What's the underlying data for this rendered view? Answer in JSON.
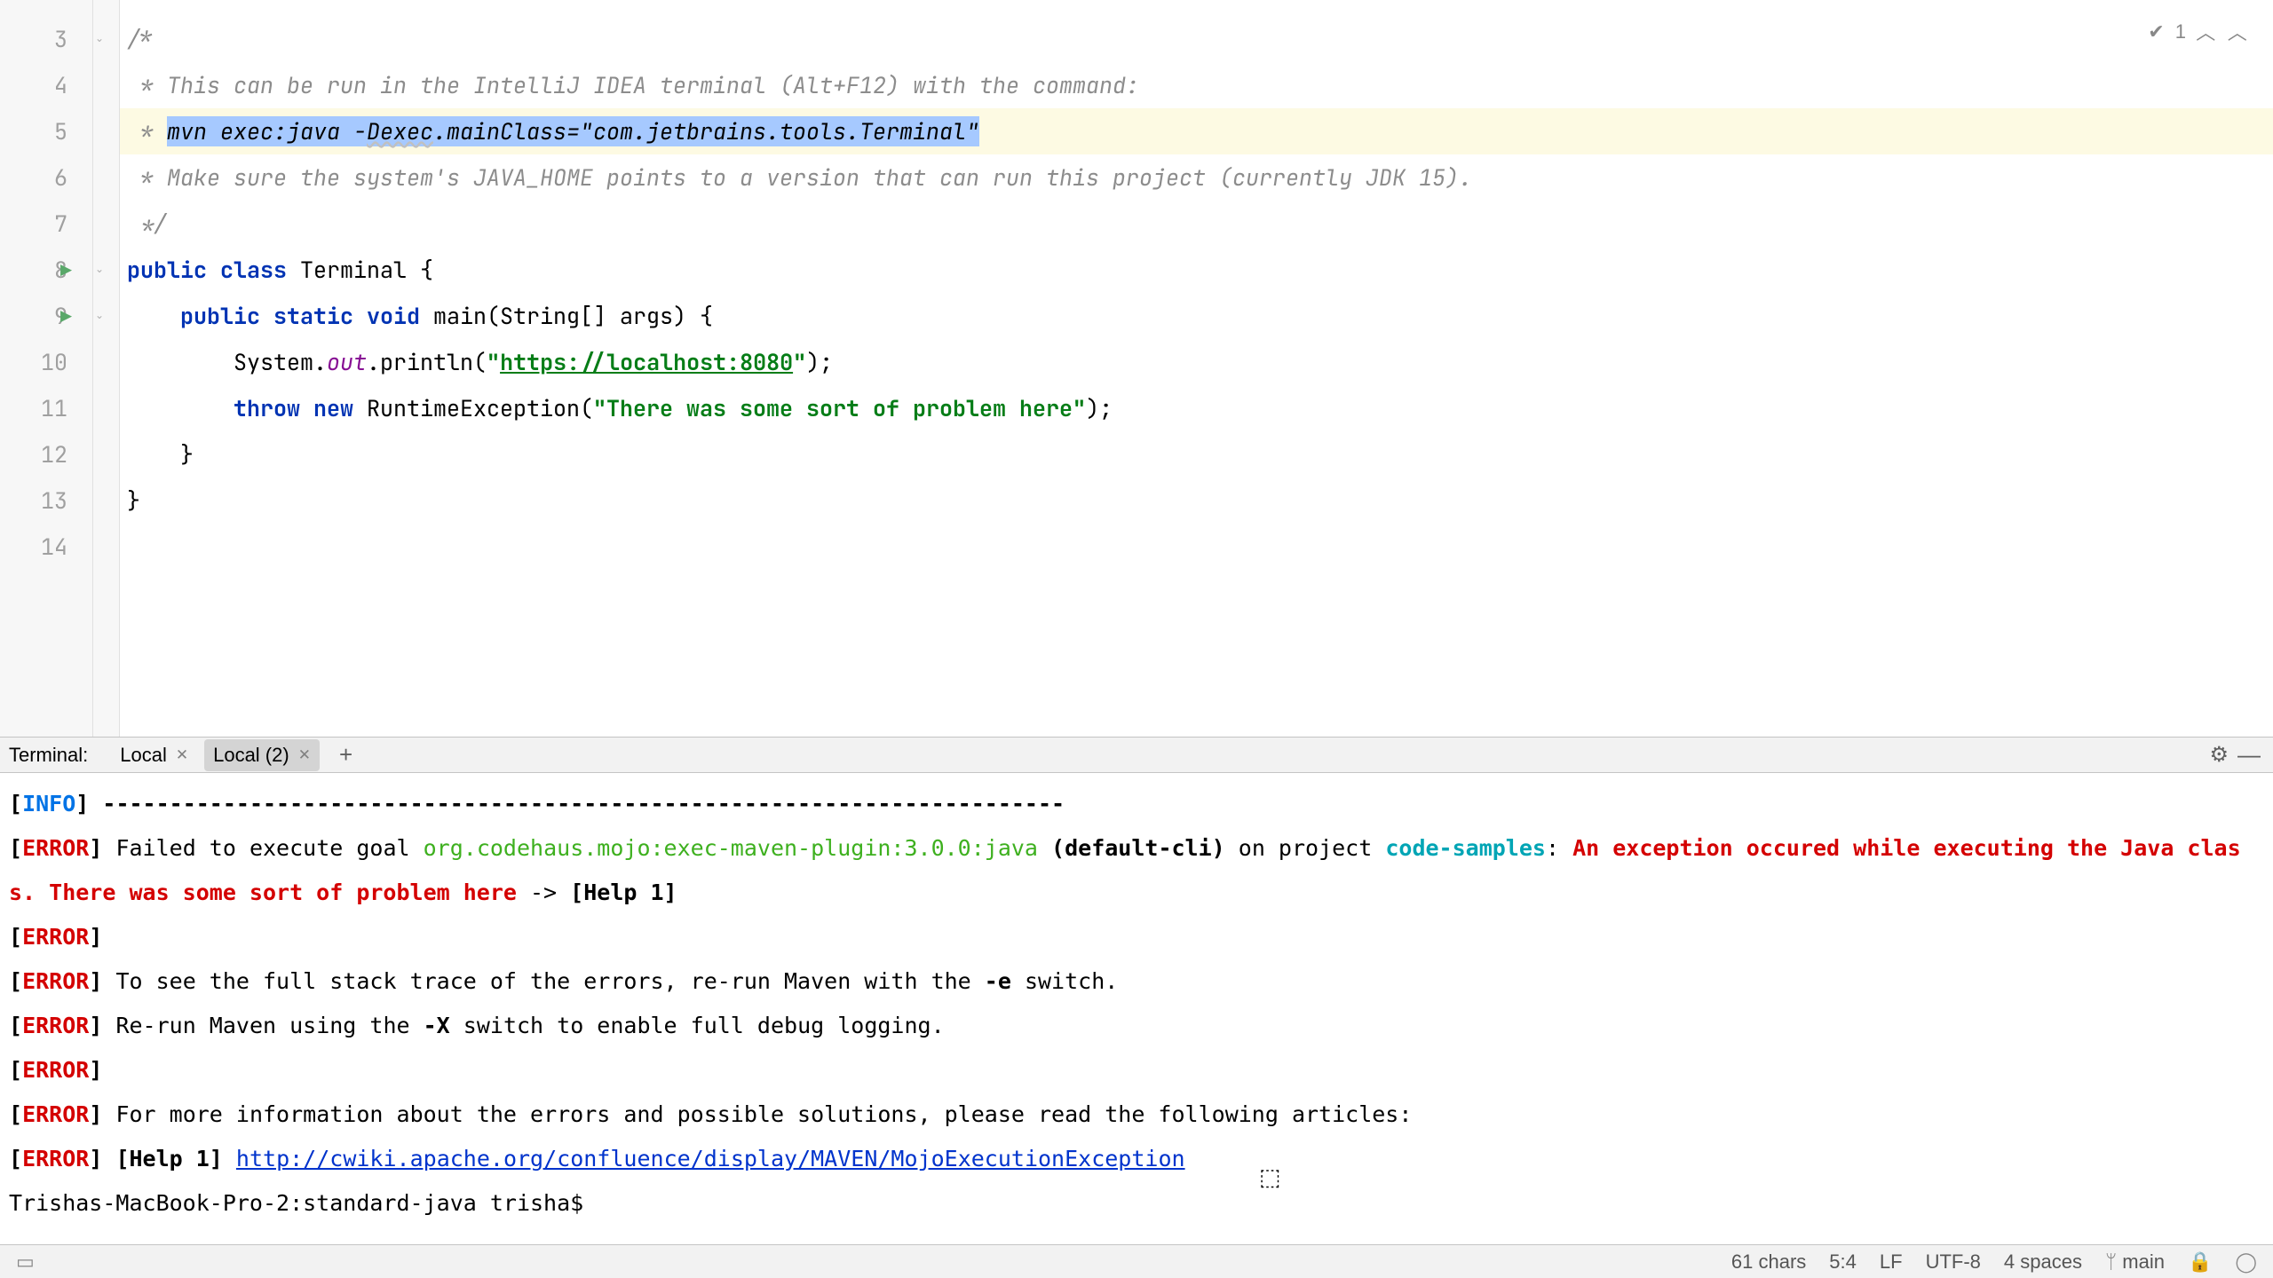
{
  "editor": {
    "lines": [
      {
        "num": "3",
        "segments": [
          {
            "t": "/*",
            "cls": "c-comment"
          }
        ]
      },
      {
        "num": "4",
        "segments": [
          {
            "t": " * This can be run in the IntelliJ IDEA terminal (Alt+F12) with the command:",
            "cls": "c-comment"
          }
        ]
      },
      {
        "num": "5",
        "highlight": true,
        "segments": [
          {
            "t": " * ",
            "cls": "c-comment"
          },
          {
            "t": "mvn exec:java -",
            "cls": "sel"
          },
          {
            "t": "Dexec",
            "cls": "sel wavy"
          },
          {
            "t": ".mainClass=\"com.jetbrains.tools.Terminal\"",
            "cls": "sel"
          }
        ]
      },
      {
        "num": "6",
        "segments": [
          {
            "t": " * Make sure the system's JAVA_HOME points to a version that can run this project (currently JDK 15).",
            "cls": "c-comment"
          }
        ]
      },
      {
        "num": "7",
        "segments": [
          {
            "t": " */",
            "cls": "c-comment"
          }
        ]
      },
      {
        "num": "8",
        "run": true,
        "segments": [
          {
            "t": "public class ",
            "cls": "c-kw"
          },
          {
            "t": "Terminal {",
            "cls": "c-type"
          }
        ]
      },
      {
        "num": "9",
        "run": true,
        "segments": [
          {
            "t": "    ",
            "cls": ""
          },
          {
            "t": "public static void ",
            "cls": "c-kw"
          },
          {
            "t": "main(String[] args) {",
            "cls": "c-method"
          }
        ]
      },
      {
        "num": "10",
        "segments": [
          {
            "t": "        System.",
            "cls": "c-type"
          },
          {
            "t": "out",
            "cls": "c-field"
          },
          {
            "t": ".println(",
            "cls": "c-type"
          },
          {
            "t": "\"",
            "cls": "c-str"
          },
          {
            "t": "https://localhost:8080",
            "cls": "c-url"
          },
          {
            "t": "\"",
            "cls": "c-str"
          },
          {
            "t": ");",
            "cls": "c-punct"
          }
        ]
      },
      {
        "num": "11",
        "segments": [
          {
            "t": "        ",
            "cls": ""
          },
          {
            "t": "throw new ",
            "cls": "c-kw"
          },
          {
            "t": "RuntimeException(",
            "cls": "c-type"
          },
          {
            "t": "\"There was some sort of problem here\"",
            "cls": "c-str"
          },
          {
            "t": ");",
            "cls": "c-punct"
          }
        ]
      },
      {
        "num": "12",
        "segments": [
          {
            "t": "    }",
            "cls": "c-type"
          }
        ]
      },
      {
        "num": "13",
        "segments": [
          {
            "t": "}",
            "cls": "c-type"
          }
        ]
      },
      {
        "num": "14",
        "segments": [
          {
            "t": "",
            "cls": ""
          }
        ]
      }
    ],
    "inspection_count": "1"
  },
  "terminal": {
    "label": "Terminal:",
    "tabs": [
      {
        "label": "Local",
        "active": false
      },
      {
        "label": "Local (2)",
        "active": true
      }
    ],
    "lines": [
      [
        {
          "t": "[",
          "cls": "t-black-b"
        },
        {
          "t": "INFO",
          "cls": "t-info"
        },
        {
          "t": "] ",
          "cls": "t-black-b"
        },
        {
          "t": "------------------------------------------------------------------------",
          "cls": "t-black-b"
        }
      ],
      [
        {
          "t": "[",
          "cls": "t-black-b"
        },
        {
          "t": "ERROR",
          "cls": "t-error"
        },
        {
          "t": "] ",
          "cls": "t-black-b"
        },
        {
          "t": "Failed to execute goal ",
          "cls": "t-plain"
        },
        {
          "t": "org.codehaus.mojo:exec-maven-plugin:3.0.0:java",
          "cls": "t-plugin"
        },
        {
          "t": " ",
          "cls": "t-plain"
        },
        {
          "t": "(default-cli)",
          "cls": "t-black-b"
        },
        {
          "t": " on project ",
          "cls": "t-plain"
        },
        {
          "t": "code-samples",
          "cls": "t-cyan"
        },
        {
          "t": ": ",
          "cls": "t-plain"
        },
        {
          "t": "An exception occured while executing the Java class. There was some sort of problem here",
          "cls": "t-red"
        },
        {
          "t": " -> ",
          "cls": "t-plain"
        },
        {
          "t": "[Help 1]",
          "cls": "t-black-b"
        }
      ],
      [
        {
          "t": "[",
          "cls": "t-black-b"
        },
        {
          "t": "ERROR",
          "cls": "t-error"
        },
        {
          "t": "] ",
          "cls": "t-black-b"
        }
      ],
      [
        {
          "t": "[",
          "cls": "t-black-b"
        },
        {
          "t": "ERROR",
          "cls": "t-error"
        },
        {
          "t": "] ",
          "cls": "t-black-b"
        },
        {
          "t": "To see the full stack trace of the errors, re-run Maven with the ",
          "cls": "t-plain"
        },
        {
          "t": "-e",
          "cls": "t-black-b"
        },
        {
          "t": " switch.",
          "cls": "t-plain"
        }
      ],
      [
        {
          "t": "[",
          "cls": "t-black-b"
        },
        {
          "t": "ERROR",
          "cls": "t-error"
        },
        {
          "t": "] ",
          "cls": "t-black-b"
        },
        {
          "t": "Re-run Maven using the ",
          "cls": "t-plain"
        },
        {
          "t": "-X",
          "cls": "t-black-b"
        },
        {
          "t": " switch to enable full debug logging.",
          "cls": "t-plain"
        }
      ],
      [
        {
          "t": "[",
          "cls": "t-black-b"
        },
        {
          "t": "ERROR",
          "cls": "t-error"
        },
        {
          "t": "] ",
          "cls": "t-black-b"
        }
      ],
      [
        {
          "t": "[",
          "cls": "t-black-b"
        },
        {
          "t": "ERROR",
          "cls": "t-error"
        },
        {
          "t": "] ",
          "cls": "t-black-b"
        },
        {
          "t": "For more information about the errors and possible solutions, please read the following articles:",
          "cls": "t-plain"
        }
      ],
      [
        {
          "t": "[",
          "cls": "t-black-b"
        },
        {
          "t": "ERROR",
          "cls": "t-error"
        },
        {
          "t": "] ",
          "cls": "t-black-b"
        },
        {
          "t": "[Help 1]",
          "cls": "t-black-b"
        },
        {
          "t": " ",
          "cls": "t-plain"
        },
        {
          "t": "http://cwiki.apache.org/confluence/display/MAVEN/MojoExecutionException",
          "cls": "t-link"
        }
      ],
      [
        {
          "t": "Trishas-MacBook-Pro-2:standard-java trisha$ ",
          "cls": "t-plain"
        }
      ]
    ]
  },
  "status": {
    "chars": "61 chars",
    "pos": "5:4",
    "line_sep": "LF",
    "encoding": "UTF-8",
    "indent": "4 spaces",
    "branch": "main"
  }
}
